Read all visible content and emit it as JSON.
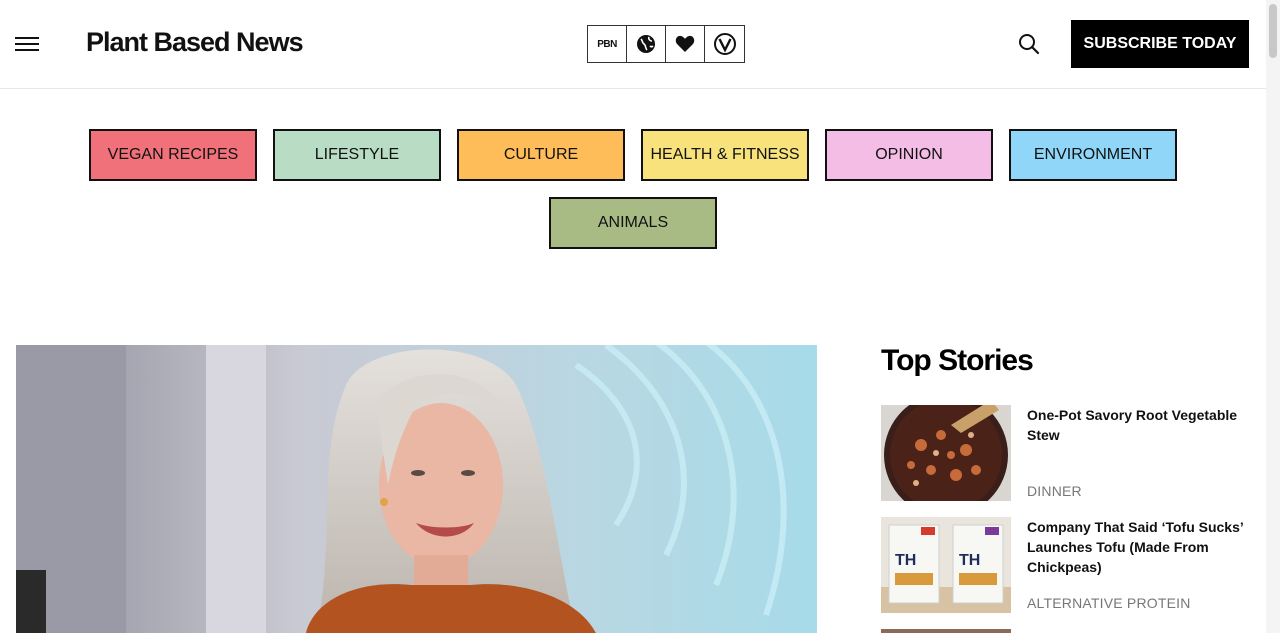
{
  "header": {
    "brand": "Plant Based News",
    "badges": [
      {
        "icon": "pbn-logo-icon",
        "label": "PBN"
      },
      {
        "icon": "globe-icon"
      },
      {
        "icon": "heart-icon"
      },
      {
        "icon": "vegan-v-icon"
      }
    ],
    "subscribe_label": "SUBSCRIBE TODAY"
  },
  "categories": [
    {
      "label": "VEGAN RECIPES",
      "color": "#f0717a"
    },
    {
      "label": "LIFESTYLE",
      "color": "#b8dcc4"
    },
    {
      "label": "CULTURE",
      "color": "#ffbd5a"
    },
    {
      "label": "HEALTH & FITNESS",
      "color": "#f7e27c"
    },
    {
      "label": "OPINION",
      "color": "#f4bde6"
    },
    {
      "label": "ENVIRONMENT",
      "color": "#8fd6f8"
    },
    {
      "label": "ANIMALS",
      "color": "#a9bb85"
    }
  ],
  "top_stories": {
    "title": "Top Stories",
    "items": [
      {
        "title": "One-Pot Savory Root Vegetable Stew",
        "category": "DINNER"
      },
      {
        "title": "Company That Said ‘Tofu Sucks’ Launches Tofu (Made From Chickpeas)",
        "category": "ALTERNATIVE PROTEIN"
      }
    ]
  }
}
